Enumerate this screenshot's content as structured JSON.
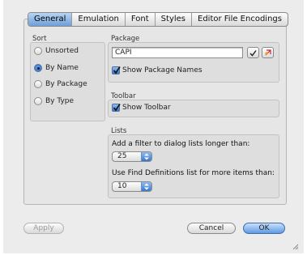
{
  "tabs": [
    "General",
    "Emulation",
    "Font",
    "Styles",
    "Editor File Encodings"
  ],
  "sort": {
    "title": "Sort",
    "options": [
      "Unsorted",
      "By Name",
      "By Package",
      "By Type"
    ],
    "selected": "By Name"
  },
  "package": {
    "title": "Package",
    "value": "CAPI",
    "show_names_label": "Show Package Names",
    "show_names_checked": true
  },
  "toolbar": {
    "title": "Toolbar",
    "show_label": "Show Toolbar",
    "show_checked": true
  },
  "lists": {
    "title": "Lists",
    "filter_label": "Add a filter to dialog lists longer than:",
    "filter_value": "25",
    "find_label": "Use Find Definitions list for more items than:",
    "find_value": "10"
  },
  "buttons": {
    "apply": "Apply",
    "cancel": "Cancel",
    "ok": "OK"
  }
}
